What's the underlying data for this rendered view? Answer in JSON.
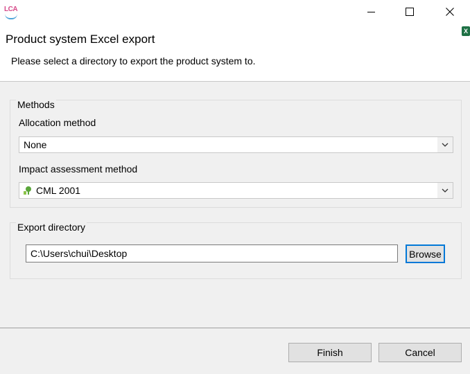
{
  "window": {
    "app_icon_text": "LCA",
    "icons": {
      "app": "lca-logo-icon",
      "minimize": "minimize-icon",
      "maximize": "maximize-icon",
      "close": "close-icon",
      "excel": "excel-icon",
      "method": "impact-method-icon",
      "dropdown": "chevron-down-icon"
    }
  },
  "header": {
    "title": "Product system Excel export",
    "description": "Please select a directory to export the product system to."
  },
  "methods_group": {
    "legend": "Methods",
    "allocation_label": "Allocation method",
    "allocation_value": "None",
    "impact_label": "Impact assessment method",
    "impact_value": "CML 2001"
  },
  "export_group": {
    "legend": "Export directory",
    "path_value": "C:\\Users\\chui\\Desktop",
    "browse_label": "Browse"
  },
  "footer": {
    "finish_label": "Finish",
    "cancel_label": "Cancel"
  },
  "colors": {
    "accent": "#0078d7",
    "app_icon_pink": "#d64b8a",
    "app_icon_blue": "#4ea5d9",
    "excel_green": "#1e7145",
    "method_icon_green": "#5aa63a"
  }
}
